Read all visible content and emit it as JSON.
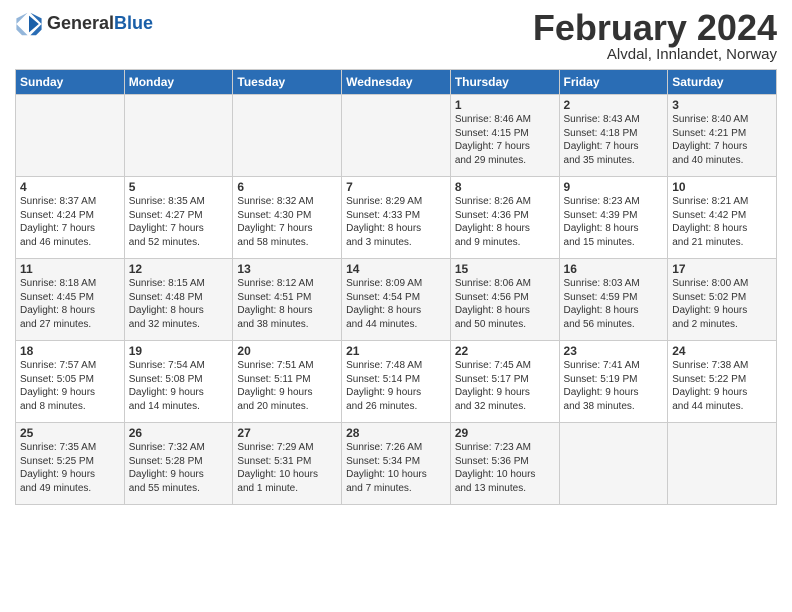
{
  "header": {
    "logo_general": "General",
    "logo_blue": "Blue",
    "month_title": "February 2024",
    "location": "Alvdal, Innlandet, Norway"
  },
  "weekdays": [
    "Sunday",
    "Monday",
    "Tuesday",
    "Wednesday",
    "Thursday",
    "Friday",
    "Saturday"
  ],
  "weeks": [
    [
      {
        "day": "",
        "info": ""
      },
      {
        "day": "",
        "info": ""
      },
      {
        "day": "",
        "info": ""
      },
      {
        "day": "",
        "info": ""
      },
      {
        "day": "1",
        "info": "Sunrise: 8:46 AM\nSunset: 4:15 PM\nDaylight: 7 hours\nand 29 minutes."
      },
      {
        "day": "2",
        "info": "Sunrise: 8:43 AM\nSunset: 4:18 PM\nDaylight: 7 hours\nand 35 minutes."
      },
      {
        "day": "3",
        "info": "Sunrise: 8:40 AM\nSunset: 4:21 PM\nDaylight: 7 hours\nand 40 minutes."
      }
    ],
    [
      {
        "day": "4",
        "info": "Sunrise: 8:37 AM\nSunset: 4:24 PM\nDaylight: 7 hours\nand 46 minutes."
      },
      {
        "day": "5",
        "info": "Sunrise: 8:35 AM\nSunset: 4:27 PM\nDaylight: 7 hours\nand 52 minutes."
      },
      {
        "day": "6",
        "info": "Sunrise: 8:32 AM\nSunset: 4:30 PM\nDaylight: 7 hours\nand 58 minutes."
      },
      {
        "day": "7",
        "info": "Sunrise: 8:29 AM\nSunset: 4:33 PM\nDaylight: 8 hours\nand 3 minutes."
      },
      {
        "day": "8",
        "info": "Sunrise: 8:26 AM\nSunset: 4:36 PM\nDaylight: 8 hours\nand 9 minutes."
      },
      {
        "day": "9",
        "info": "Sunrise: 8:23 AM\nSunset: 4:39 PM\nDaylight: 8 hours\nand 15 minutes."
      },
      {
        "day": "10",
        "info": "Sunrise: 8:21 AM\nSunset: 4:42 PM\nDaylight: 8 hours\nand 21 minutes."
      }
    ],
    [
      {
        "day": "11",
        "info": "Sunrise: 8:18 AM\nSunset: 4:45 PM\nDaylight: 8 hours\nand 27 minutes."
      },
      {
        "day": "12",
        "info": "Sunrise: 8:15 AM\nSunset: 4:48 PM\nDaylight: 8 hours\nand 32 minutes."
      },
      {
        "day": "13",
        "info": "Sunrise: 8:12 AM\nSunset: 4:51 PM\nDaylight: 8 hours\nand 38 minutes."
      },
      {
        "day": "14",
        "info": "Sunrise: 8:09 AM\nSunset: 4:54 PM\nDaylight: 8 hours\nand 44 minutes."
      },
      {
        "day": "15",
        "info": "Sunrise: 8:06 AM\nSunset: 4:56 PM\nDaylight: 8 hours\nand 50 minutes."
      },
      {
        "day": "16",
        "info": "Sunrise: 8:03 AM\nSunset: 4:59 PM\nDaylight: 8 hours\nand 56 minutes."
      },
      {
        "day": "17",
        "info": "Sunrise: 8:00 AM\nSunset: 5:02 PM\nDaylight: 9 hours\nand 2 minutes."
      }
    ],
    [
      {
        "day": "18",
        "info": "Sunrise: 7:57 AM\nSunset: 5:05 PM\nDaylight: 9 hours\nand 8 minutes."
      },
      {
        "day": "19",
        "info": "Sunrise: 7:54 AM\nSunset: 5:08 PM\nDaylight: 9 hours\nand 14 minutes."
      },
      {
        "day": "20",
        "info": "Sunrise: 7:51 AM\nSunset: 5:11 PM\nDaylight: 9 hours\nand 20 minutes."
      },
      {
        "day": "21",
        "info": "Sunrise: 7:48 AM\nSunset: 5:14 PM\nDaylight: 9 hours\nand 26 minutes."
      },
      {
        "day": "22",
        "info": "Sunrise: 7:45 AM\nSunset: 5:17 PM\nDaylight: 9 hours\nand 32 minutes."
      },
      {
        "day": "23",
        "info": "Sunrise: 7:41 AM\nSunset: 5:19 PM\nDaylight: 9 hours\nand 38 minutes."
      },
      {
        "day": "24",
        "info": "Sunrise: 7:38 AM\nSunset: 5:22 PM\nDaylight: 9 hours\nand 44 minutes."
      }
    ],
    [
      {
        "day": "25",
        "info": "Sunrise: 7:35 AM\nSunset: 5:25 PM\nDaylight: 9 hours\nand 49 minutes."
      },
      {
        "day": "26",
        "info": "Sunrise: 7:32 AM\nSunset: 5:28 PM\nDaylight: 9 hours\nand 55 minutes."
      },
      {
        "day": "27",
        "info": "Sunrise: 7:29 AM\nSunset: 5:31 PM\nDaylight: 10 hours\nand 1 minute."
      },
      {
        "day": "28",
        "info": "Sunrise: 7:26 AM\nSunset: 5:34 PM\nDaylight: 10 hours\nand 7 minutes."
      },
      {
        "day": "29",
        "info": "Sunrise: 7:23 AM\nSunset: 5:36 PM\nDaylight: 10 hours\nand 13 minutes."
      },
      {
        "day": "",
        "info": ""
      },
      {
        "day": "",
        "info": ""
      }
    ]
  ]
}
